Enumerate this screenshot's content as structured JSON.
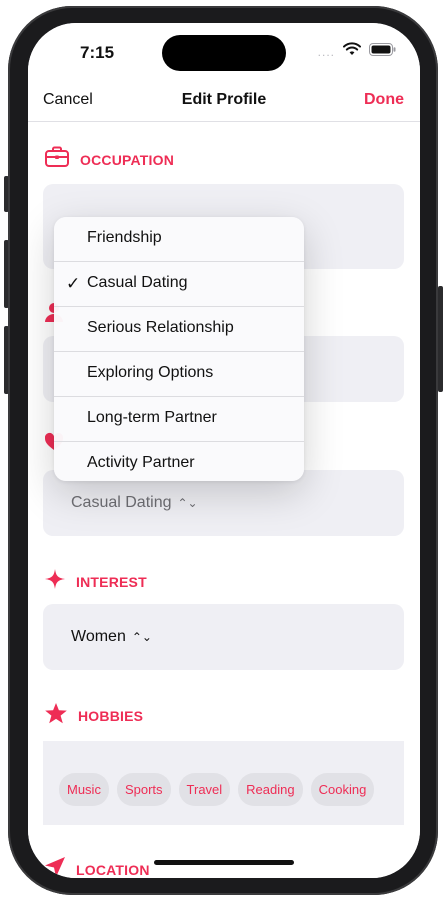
{
  "status_bar": {
    "time": "7:15",
    "signal": "....",
    "icons": [
      "wifi-icon",
      "battery-icon"
    ]
  },
  "nav": {
    "cancel": "Cancel",
    "title": "Edit Profile",
    "done": "Done"
  },
  "sections": {
    "occupation": {
      "label": "OCCUPATION",
      "icon": "briefcase-icon"
    },
    "relationship_goal": {
      "icon": "heart-icon",
      "value": "Casual Dating"
    },
    "interest": {
      "label": "INTEREST",
      "icon": "sparkle-icon",
      "value": "Women"
    },
    "hobbies": {
      "label": "HOBBIES",
      "icon": "star-icon",
      "items": [
        "Music",
        "Sports",
        "Travel",
        "Reading",
        "Cooking"
      ]
    },
    "location": {
      "label": "LOCATION",
      "icon": "location-arrow-icon"
    }
  },
  "menu": {
    "options": [
      "Friendship",
      "Casual Dating",
      "Serious Relationship",
      "Exploring Options",
      "Long-term Partner",
      "Activity Partner"
    ],
    "selected": "Casual Dating",
    "check": "✓"
  },
  "colors": {
    "accent": "#ee2d55",
    "field_bg": "#efeff4"
  }
}
